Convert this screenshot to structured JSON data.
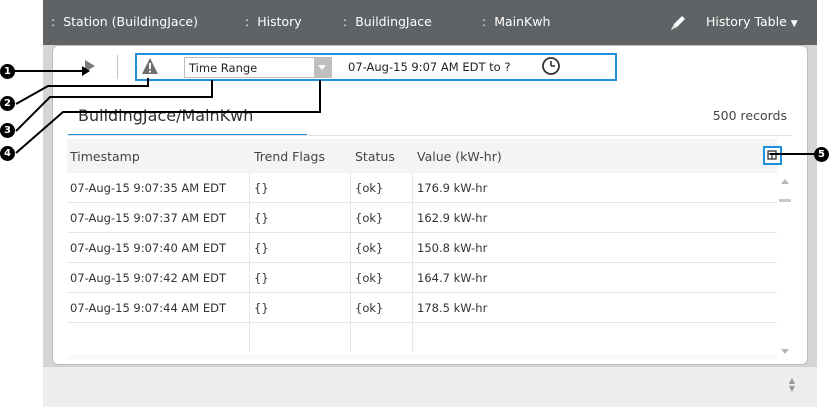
{
  "breadcrumb": [
    {
      "label": "Station (BuildingJace)"
    },
    {
      "label": "History"
    },
    {
      "label": "BuildingJace"
    },
    {
      "label": "MainKwh"
    }
  ],
  "view_selector": {
    "label": "History Table"
  },
  "toolbar": {
    "time_range_select": "Time Range",
    "range_text": "07-Aug-15 9:07 AM EDT to ?"
  },
  "tab": {
    "label": "BuildingJace/MainKwh"
  },
  "record_count": "500 records",
  "table": {
    "columns": [
      "Timestamp",
      "Trend Flags",
      "Status",
      "Value (kW-hr)"
    ],
    "rows": [
      {
        "timestamp": "07-Aug-15 9:07:35 AM EDT",
        "flags": "{}",
        "status": "{ok}",
        "value": "176.9 kW-hr"
      },
      {
        "timestamp": "07-Aug-15 9:07:37 AM EDT",
        "flags": "{}",
        "status": "{ok}",
        "value": "162.9 kW-hr"
      },
      {
        "timestamp": "07-Aug-15 9:07:40 AM EDT",
        "flags": "{}",
        "status": "{ok}",
        "value": "150.8 kW-hr"
      },
      {
        "timestamp": "07-Aug-15 9:07:42 AM EDT",
        "flags": "{}",
        "status": "{ok}",
        "value": "164.7 kW-hr"
      },
      {
        "timestamp": "07-Aug-15 9:07:44 AM EDT",
        "flags": "{}",
        "status": "{ok}",
        "value": "178.5 kW-hr"
      }
    ]
  },
  "callouts": [
    "1",
    "2",
    "3",
    "4",
    "5"
  ],
  "icons": {
    "edit": "pencil-icon",
    "run": "play-icon",
    "alarm": "warning-triangle-icon",
    "time": "clock-icon",
    "column_options": "table-options-icon"
  },
  "colors": {
    "topbar": "#5f6365",
    "accent": "#1f8fe0",
    "callout": "#000000"
  }
}
